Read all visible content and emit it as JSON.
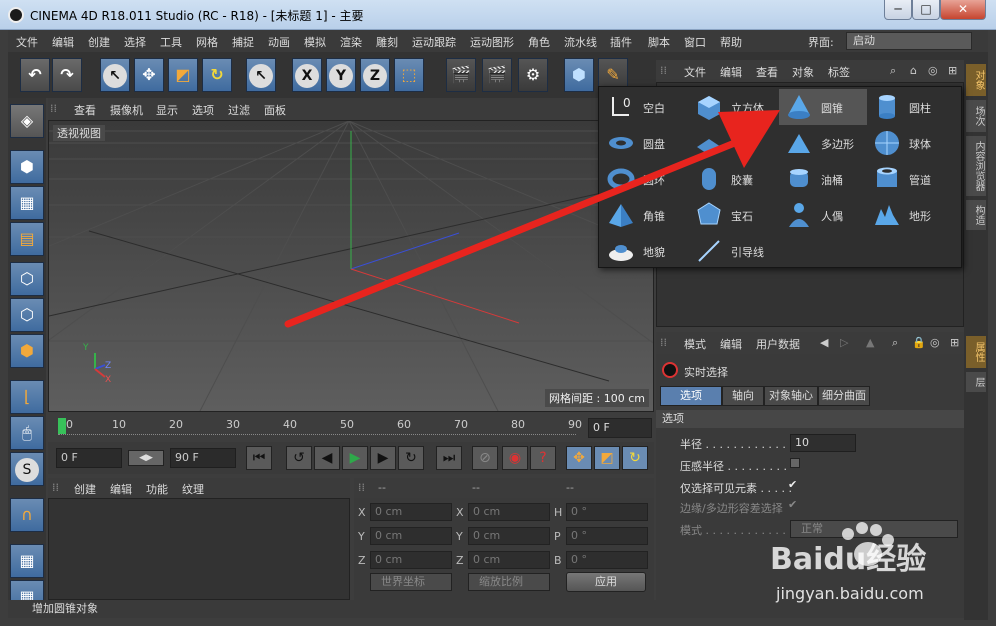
{
  "window": {
    "title": "CINEMA 4D R18.011 Studio (RC - R18) - [未标题 1] - 主要",
    "min": "─",
    "max": "□",
    "close": "✕"
  },
  "menubar": {
    "items": [
      "文件",
      "编辑",
      "创建",
      "选择",
      "工具",
      "网格",
      "捕捉",
      "动画",
      "模拟",
      "渲染",
      "雕刻",
      "运动跟踪",
      "运动图形",
      "角色",
      "流水线",
      "插件",
      "脚本",
      "窗口",
      "帮助"
    ],
    "layout_label": "界面:",
    "layout_value": "启动"
  },
  "viewport": {
    "menu": [
      "查看",
      "摄像机",
      "显示",
      "选项",
      "过滤",
      "面板"
    ],
    "label": "透视视图",
    "grid_spacing": "网格间距 : 100 cm",
    "axis": {
      "y": "Y",
      "z": "Z",
      "x": "X"
    }
  },
  "timeline": {
    "ticks": [
      "0",
      "10",
      "20",
      "30",
      "40",
      "50",
      "60",
      "70",
      "80",
      "90"
    ],
    "frame": "0 F"
  },
  "transport": {
    "start": "0 F",
    "end": "90 F"
  },
  "material": {
    "menu": [
      "创建",
      "编辑",
      "功能",
      "纹理"
    ]
  },
  "coords": {
    "headers": [
      "--",
      "--",
      "--"
    ],
    "rows": [
      {
        "a": "X",
        "a_val": "0 cm",
        "b": "X",
        "b_val": "0 cm",
        "c": "H",
        "c_val": "0 °"
      },
      {
        "a": "Y",
        "a_val": "0 cm",
        "b": "Y",
        "b_val": "0 cm",
        "c": "P",
        "c_val": "0 °"
      },
      {
        "a": "Z",
        "a_val": "0 cm",
        "b": "Z",
        "b_val": "0 cm",
        "c": "B",
        "c_val": "0 °"
      }
    ],
    "world": "世界坐标",
    "scale": "缩放比例",
    "apply": "应用"
  },
  "status": {
    "text": "增加圆锥对象"
  },
  "object_manager": {
    "menu": [
      "文件",
      "编辑",
      "查看",
      "对象",
      "标签"
    ]
  },
  "attributes": {
    "menu": [
      "模式",
      "编辑",
      "用户数据"
    ],
    "live_select": "实时选择",
    "tabs": [
      "选项",
      "轴向",
      "对象轴心",
      "细分曲面"
    ],
    "section": "选项",
    "radius_label": "半径 . . . . . . . . . . . . . .",
    "radius_value": "10",
    "pressure_label": "压感半径 . . . . . . . . .",
    "visible_label": "仅选择可见元素 . . . . .",
    "visible_check": "✔",
    "tolerance_label": "边缘/多边形容差选择",
    "tolerance_check": "✔",
    "mode_label": "模式 . . . . . . . . . . . . . .",
    "mode_value": "正常"
  },
  "right_tabs": [
    "对象",
    "场次",
    "内容浏览器",
    "构造",
    "属性",
    "层"
  ],
  "popup": {
    "items": [
      {
        "label": "空白",
        "icon": "null-icon"
      },
      {
        "label": "立方体",
        "icon": "cube-icon"
      },
      {
        "label": "圆锥",
        "icon": "cone-icon"
      },
      {
        "label": "圆柱",
        "icon": "cylinder-icon"
      },
      {
        "label": "圆盘",
        "icon": "disc-icon"
      },
      {
        "label": "平面",
        "icon": "plane-icon"
      },
      {
        "label": "多边形",
        "icon": "polygon-icon"
      },
      {
        "label": "球体",
        "icon": "sphere-icon"
      },
      {
        "label": "圆环",
        "icon": "torus-icon"
      },
      {
        "label": "胶囊",
        "icon": "capsule-icon"
      },
      {
        "label": "油桶",
        "icon": "oil-tank-icon"
      },
      {
        "label": "管道",
        "icon": "tube-icon"
      },
      {
        "label": "角锥",
        "icon": "pyramid-icon"
      },
      {
        "label": "宝石",
        "icon": "platonic-icon"
      },
      {
        "label": "人偶",
        "icon": "figure-icon"
      },
      {
        "label": "地形",
        "icon": "landscape-icon"
      },
      {
        "label": "地貌",
        "icon": "relief-icon"
      },
      {
        "label": "引导线",
        "icon": "guide-icon"
      }
    ]
  },
  "watermark": {
    "brand": "Baidu经验",
    "url": "jingyan.baidu.com"
  },
  "colors": {
    "arrow": "#e8241e",
    "accent_blue": "#4f79aa",
    "highlight_orange": "#f2a93b"
  }
}
